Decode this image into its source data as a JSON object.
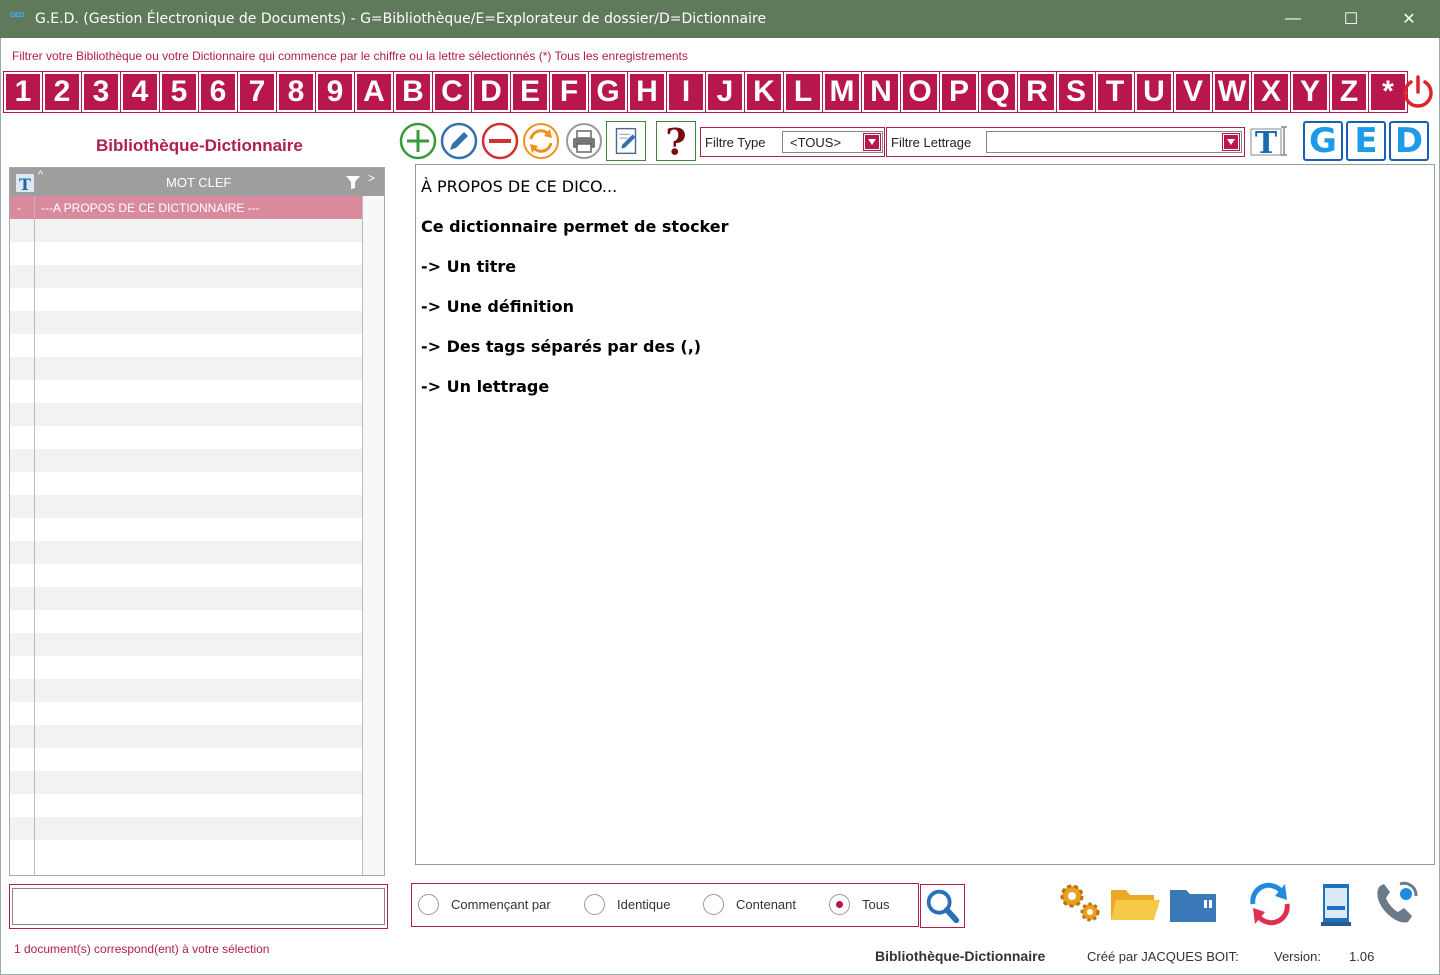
{
  "window": {
    "app_icon_text": "GED",
    "title": "G.E.D. (Gestion Électronique de Documents) - G=Bibliothèque/E=Explorateur de dossier/D=Dictionnaire",
    "minimize_label": "—",
    "maximize_label": "☐",
    "close_label": "✕"
  },
  "hint": "Filtrer votre Bibliothèque ou votre Dictionnaire qui commence par le chiffre ou la lettre sélectionnés (*) Tous les enregistrements",
  "letters": [
    "1",
    "2",
    "3",
    "4",
    "5",
    "6",
    "7",
    "8",
    "9",
    "A",
    "B",
    "C",
    "D",
    "E",
    "F",
    "G",
    "H",
    "I",
    "J",
    "K",
    "L",
    "M",
    "N",
    "O",
    "P",
    "Q",
    "R",
    "S",
    "T",
    "U",
    "V",
    "W",
    "X",
    "Y",
    "Z",
    "*"
  ],
  "section_title": "Bibliothèque-Dictionnaire",
  "toolbar": {
    "icons": [
      "add-icon",
      "edit-pencil-icon",
      "remove-icon",
      "refresh-icon",
      "print-icon",
      "edit-document-icon",
      "help-icon"
    ]
  },
  "filters": {
    "type_label": "Filtre Type",
    "type_value": "<TOUS>",
    "lettrage_label": "Filtre Lettrage",
    "lettrage_value": ""
  },
  "mode_buttons": [
    "G",
    "E",
    "D"
  ],
  "list": {
    "column_header": "MOT CLEF",
    "rows": [
      {
        "marker": "-",
        "text": "---A PROPOS DE CE DICTIONNAIRE ---",
        "selected": true
      }
    ],
    "empty_rows": 28
  },
  "content": {
    "lines": [
      {
        "text": "À PROPOS DE CE DICO...",
        "bold": false
      },
      {
        "text": "Ce dictionnaire permet de stocker",
        "bold": true
      },
      {
        "text": "-> Un titre",
        "bold": true
      },
      {
        "text": "-> Une définition",
        "bold": true
      },
      {
        "text": "-> Des tags séparés par des (,)",
        "bold": true
      },
      {
        "text": "-> Un lettrage",
        "bold": true
      }
    ]
  },
  "search": {
    "value": "",
    "options": [
      {
        "label": "Commençant par",
        "checked": false
      },
      {
        "label": "Identique",
        "checked": false
      },
      {
        "label": "Contenant",
        "checked": false
      },
      {
        "label": "Tous",
        "checked": true
      }
    ]
  },
  "bottom_icons": [
    "settings-gears-icon",
    "folder-icon",
    "sd-card-icon",
    "sync-icon",
    "book-icon",
    "phone-icon"
  ],
  "status": "1 document(s) correspond(ent) à votre sélection",
  "footer": {
    "name": "Bibliothèque-Dictionnaire",
    "credit": "Créé par JACQUES BOIT:",
    "version_label": "Version:",
    "version": "1.06"
  },
  "colors": {
    "accent": "#b7174a",
    "titlebar": "#5e7a5a",
    "list_header": "#9e9e9e",
    "selected_row": "#d98a9c",
    "blue": "#1e9be8"
  }
}
